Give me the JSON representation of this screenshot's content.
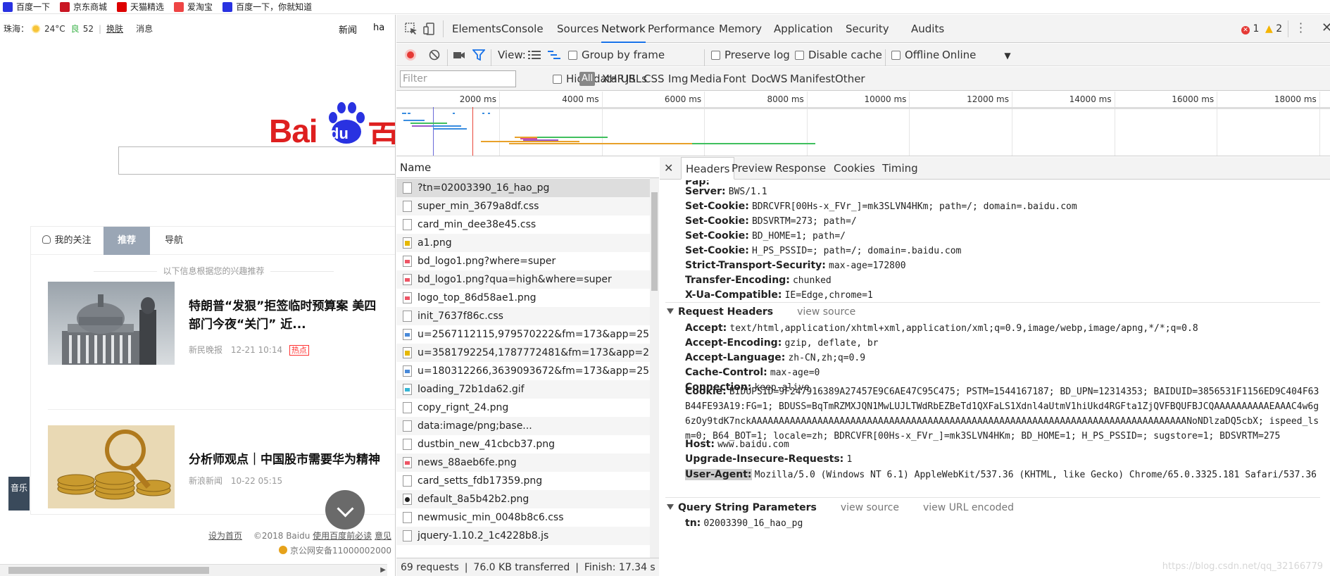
{
  "bookmarks": [
    {
      "label": "百度一下",
      "icon": "baidu-paw-icon",
      "color": "#2932e1"
    },
    {
      "label": "京东商城",
      "icon": "jd-icon",
      "color": "#c91623"
    },
    {
      "label": "天猫精选",
      "icon": "tmall-icon",
      "color": "#d00"
    },
    {
      "label": "爱淘宝",
      "icon": "aitaobao-icon",
      "color": "#e44"
    },
    {
      "label": "百度一下，你就知道",
      "icon": "baidu-paw-icon",
      "color": "#2932e1"
    }
  ],
  "page": {
    "topbar": {
      "city": "珠海：",
      "temp": "24°C",
      "aqi_icon": "良",
      "aqi": "52",
      "skin_link": "换肤",
      "msg_link": "消息",
      "news_link": "新闻",
      "hao_link": "ha"
    },
    "logo": {
      "part1": "Bai",
      "part2": "du",
      "part3": "百"
    },
    "feed": {
      "tabs": [
        "我的关注",
        "推荐",
        "导航"
      ],
      "hint": "以下信息根据您的兴趣推荐",
      "items": [
        {
          "title_line1": "特朗普“发狠”拒签临时预算案 美四",
          "title_line2": "部门今夜“关门” 近...",
          "source": "新民晚报",
          "time": "12-21 10:14",
          "tag": "热点"
        },
        {
          "title_line1": "分析师观点｜中国股市需要华为精神",
          "title_line2": "",
          "source": "新浪新闻",
          "time": "10-22 05:15",
          "tag": ""
        }
      ],
      "music_label": "音乐"
    },
    "footer": {
      "set_home": "设为首页",
      "copyright": "©2018 Baidu",
      "must_read": "使用百度前必读",
      "feedback": "意见",
      "icp": "京公网安备11000002000"
    }
  },
  "devtools": {
    "tabs": [
      "Elements",
      "Console",
      "Sources",
      "Network",
      "Performance",
      "Memory",
      "Application",
      "Security",
      "Audits"
    ],
    "active_tab": "Network",
    "errors": "1",
    "warnings": "2",
    "toolbar": {
      "view_label": "View:",
      "group_by_frame": "Group by frame",
      "preserve_log": "Preserve log",
      "disable_cache": "Disable cache",
      "offline": "Offline",
      "throttle": "Online"
    },
    "filterbar": {
      "filter_placeholder": "Filter",
      "hide_data_urls": "Hide data URLs",
      "types": [
        "All",
        "XHR",
        "JS",
        "CSS",
        "Img",
        "Media",
        "Font",
        "Doc",
        "WS",
        "Manifest",
        "Other"
      ]
    },
    "overview_ticks": [
      "2000 ms",
      "4000 ms",
      "6000 ms",
      "8000 ms",
      "10000 ms",
      "12000 ms",
      "14000 ms",
      "16000 ms",
      "18000 ms"
    ],
    "request_list": {
      "header": "Name",
      "rows": [
        {
          "name": "?tn=02003390_16_hao_pg",
          "icon": "doc"
        },
        {
          "name": "super_min_3679a8df.css",
          "icon": "doc"
        },
        {
          "name": "card_min_dee38e45.css",
          "icon": "doc"
        },
        {
          "name": "a1.png",
          "icon": "icoy"
        },
        {
          "name": "bd_logo1.png?where=super",
          "icon": "img"
        },
        {
          "name": "bd_logo1.png?qua=high&where=super",
          "icon": "img"
        },
        {
          "name": "logo_top_86d58ae1.png",
          "icon": "img"
        },
        {
          "name": "init_7637f86c.css",
          "icon": "doc"
        },
        {
          "name": "u=2567112115,979570222&fm=173&app=25&f=",
          "icon": "jpg"
        },
        {
          "name": "u=3581792254,1787772481&fm=173&app=25&f.",
          "icon": "icoy"
        },
        {
          "name": "u=180312266,3639093672&fm=173&app=25&f=",
          "icon": "jpg"
        },
        {
          "name": "loading_72b1da62.gif",
          "icon": "gif"
        },
        {
          "name": "copy_rignt_24.png",
          "icon": "doc"
        },
        {
          "name": "data:image/png;base...",
          "icon": "doc"
        },
        {
          "name": "dustbin_new_41cbcb37.png",
          "icon": "doc"
        },
        {
          "name": "news_88aeb6fe.png",
          "icon": "img"
        },
        {
          "name": "card_setts_fdb17359.png",
          "icon": "doc"
        },
        {
          "name": "default_8a5b42b2.png",
          "icon": "blk"
        },
        {
          "name": "newmusic_min_0048b8c6.css",
          "icon": "doc"
        },
        {
          "name": "jquery-1.10.2_1c4228b8.js",
          "icon": "doc"
        }
      ],
      "status": "69 requests  ❘  76.0 KB transferred  ❘  Finish: 17.34 s  ❘  ..."
    },
    "detail": {
      "tabs": [
        "Headers",
        "Preview",
        "Response",
        "Cookies",
        "Timing"
      ],
      "response_headers": [
        {
          "k": "Server:",
          "v": "BWS/1.1"
        },
        {
          "k": "Set-Cookie:",
          "v": "BDRCVFR[00Hs-x_FVr_]=mk3SLVN4HKm; path=/; domain=.baidu.com"
        },
        {
          "k": "Set-Cookie:",
          "v": "BDSVRTM=273; path=/"
        },
        {
          "k": "Set-Cookie:",
          "v": "BD_HOME=1; path=/"
        },
        {
          "k": "Set-Cookie:",
          "v": "H_PS_PSSID=; path=/; domain=.baidu.com"
        },
        {
          "k": "Strict-Transport-Security:",
          "v": "max-age=172800"
        },
        {
          "k": "Transfer-Encoding:",
          "v": "chunked"
        },
        {
          "k": "X-Ua-Compatible:",
          "v": "IE=Edge,chrome=1"
        }
      ],
      "request_headers_title": "Request Headers",
      "view_source": "view source",
      "request_headers": [
        {
          "k": "Accept:",
          "v": "text/html,application/xhtml+xml,application/xml;q=0.9,image/webp,image/apng,*/*;q=0.8"
        },
        {
          "k": "Accept-Encoding:",
          "v": "gzip, deflate, br"
        },
        {
          "k": "Accept-Language:",
          "v": "zh-CN,zh;q=0.9"
        },
        {
          "k": "Cache-Control:",
          "v": "max-age=0"
        },
        {
          "k": "Connection:",
          "v": "keep-alive"
        }
      ],
      "cookie_key": "Cookie:",
      "cookie_value": "BIDUPSID=9F247916389A27457E9C6AE47C95C475; PSTM=1544167187; BD_UPN=12314353; BAIDUID=3856531F1156ED9C404F63B44FE93A19:FG=1; BDUSS=BqTmRZMXJQN1MwLUJLTWdRbEZBeTd1QXFaLS1Xdnl4aUtmV1hiUkd4RGFta1ZjQVFBQUFBJCQAAAAAAAAAAEAAAC4w6g6zOy9tdK7nckAAAAAAAAAAAAAAAAAAAAAAAAAAAAAAAAAAAAAAAAAAAAAAAAAAAAAAAAAAAAAAAAAAAAAAAAAAAAAAANoNDlzaDQ5cbX; ispeed_lsm=0; B64_BOT=1; locale=zh; BDRCVFR[00Hs-x_FVr_]=mk3SLVN4HKm; BD_HOME=1; H_PS_PSSID=; sugstore=1; BDSVRTM=275",
      "after_cookie": [
        {
          "k": "Host:",
          "v": "www.baidu.com"
        },
        {
          "k": "Upgrade-Insecure-Requests:",
          "v": "1"
        }
      ],
      "ua_key": "User-Agent:",
      "ua_value": "Mozilla/5.0 (Windows NT 6.1) AppleWebKit/537.36 (KHTML, like Gecko) Chrome/65.0.3325.181 Safari/537.36",
      "qsp_title": "Query String Parameters",
      "view_url_encoded": "view URL encoded",
      "qsp": [
        {
          "k": "tn:",
          "v": "02003390_16_hao_pg"
        }
      ]
    },
    "watermark": "https://blog.csdn.net/qq_32166779"
  }
}
